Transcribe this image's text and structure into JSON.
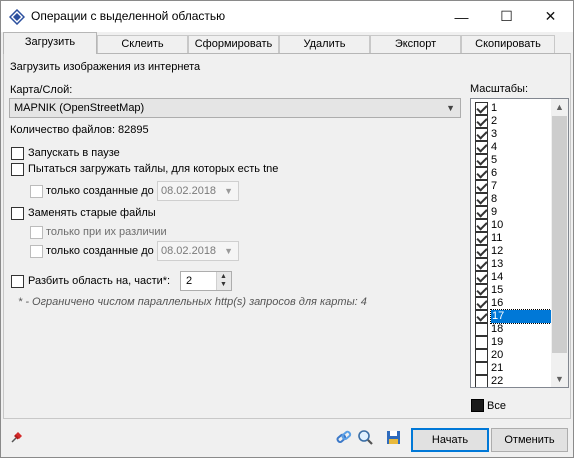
{
  "window": {
    "title": "Операции с выделенной областью"
  },
  "title_buttons": {
    "minimize": "—",
    "maximize": "☐",
    "close": "✕"
  },
  "tabs": [
    {
      "label": "Загрузить",
      "active": true
    },
    {
      "label": "Склеить",
      "active": false
    },
    {
      "label": "Сформировать",
      "active": false
    },
    {
      "label": "Удалить",
      "active": false
    },
    {
      "label": "Экспорт",
      "active": false
    },
    {
      "label": "Скопировать",
      "active": false
    }
  ],
  "download": {
    "group_title": "Загрузить изображения из интернета",
    "map_label": "Карта/Слой:",
    "map_value": "MAPNIK (OpenStreetMap)",
    "files_count": "Количество файлов: 82895",
    "start_paused": "Запускать в паузе",
    "try_tne": "Пытаться загружать тайлы, для которых есть tne",
    "only_created_before_1": "только созданные до",
    "date1": "08.02.2018",
    "replace_old": "Заменять старые файлы",
    "only_diff": "только при их различии",
    "only_created_before_2": "только созданные до",
    "date2": "08.02.2018",
    "split_label": "Разбить область на, части*:",
    "split_value": "2",
    "note": "* - Ограничено числом параллельных http(s) запросов для карты: 4"
  },
  "scales": {
    "label": "Масштабы:",
    "items": [
      {
        "label": "1",
        "checked": true
      },
      {
        "label": "2",
        "checked": true
      },
      {
        "label": "3",
        "checked": true
      },
      {
        "label": "4",
        "checked": true
      },
      {
        "label": "5",
        "checked": true
      },
      {
        "label": "6",
        "checked": true
      },
      {
        "label": "7",
        "checked": true
      },
      {
        "label": "8",
        "checked": true
      },
      {
        "label": "9",
        "checked": true
      },
      {
        "label": "10",
        "checked": true
      },
      {
        "label": "11",
        "checked": true
      },
      {
        "label": "12",
        "checked": true
      },
      {
        "label": "13",
        "checked": true
      },
      {
        "label": "14",
        "checked": true
      },
      {
        "label": "15",
        "checked": true
      },
      {
        "label": "16",
        "checked": true
      },
      {
        "label": "17",
        "checked": true,
        "selected": true
      },
      {
        "label": "18",
        "checked": false
      },
      {
        "label": "19",
        "checked": false
      },
      {
        "label": "20",
        "checked": false
      },
      {
        "label": "21",
        "checked": false
      },
      {
        "label": "22",
        "checked": false
      }
    ],
    "all_label": "Все"
  },
  "buttons": {
    "start": "Начать",
    "cancel": "Отменить"
  },
  "colors": {
    "accent": "#0078d7"
  }
}
